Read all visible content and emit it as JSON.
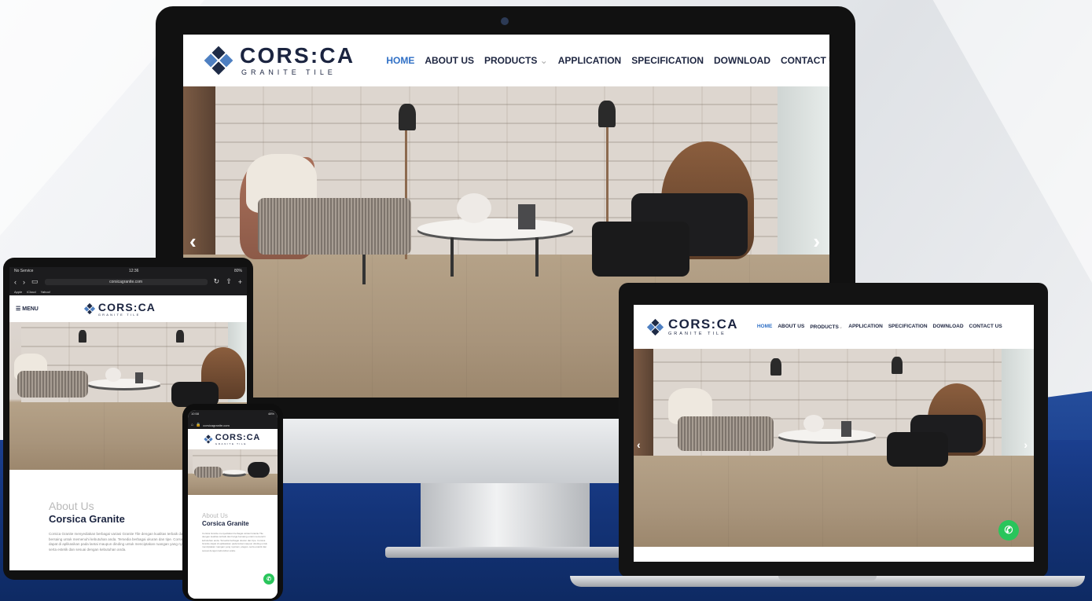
{
  "brand": {
    "name": "CORS:CA",
    "tagline": "GRANITE TILE"
  },
  "nav": {
    "items": [
      "HOME",
      "ABOUT US",
      "PRODUCTS",
      "APPLICATION",
      "SPECIFICATION",
      "DOWNLOAD",
      "CONTACT US"
    ],
    "active": "HOME",
    "products_caret": "⌄",
    "menu_label": "MENU"
  },
  "hero": {
    "prev": "‹",
    "next": "›"
  },
  "about": {
    "kicker": "About Us",
    "heading": "Corsica Granite",
    "body_ipad": "Corsica Granite menyediakan berbagai variasi Granite Tile dengan kualitas terbaik dan harga bersaing untuk memenuhi kebutuhan anda. Tersedia berbagai ukuran dan tipe. Corsica Granite dapat di aplikasikan pada lantai maupun dinding untuk menciptakan ruangan yang nyaman serta estetik dan sesuai dengan kebutuhan anda.",
    "body_phone": "Corsica Granite menyediakan berbagai variasi Granite Tile dengan kualitas terbaik dan harga bersaing untuk memenuhi kebutuhan anda. Tersedia berbagai ukuran dan tipe. Corsica Granite dapat di aplikasikan pada lantai maupun dinding untuk menciptakan ruangan yang nyaman, elegan, serta estetik dan sesuai dengan kebutuhan anda."
  },
  "ipad_status": {
    "carrier": "No Service",
    "time": "12:36",
    "battery": "80%"
  },
  "ipad_browser": {
    "url": "corsicagranite.com",
    "tabs": [
      "Apple",
      "iCloud",
      "Yahoo!"
    ]
  },
  "phone_status": {
    "time": "10:58",
    "battery": "48%"
  },
  "phone_browser": {
    "url": "corsicagranite.com"
  },
  "colors": {
    "accent": "#2f6fc5",
    "navy": "#1b2440",
    "desk": "#143479",
    "whatsapp": "#29c55b"
  },
  "icons": [
    "whatsapp-icon",
    "chevron-left-icon",
    "chevron-right-icon",
    "hamburger-icon",
    "lock-icon",
    "share-icon",
    "reload-icon"
  ]
}
